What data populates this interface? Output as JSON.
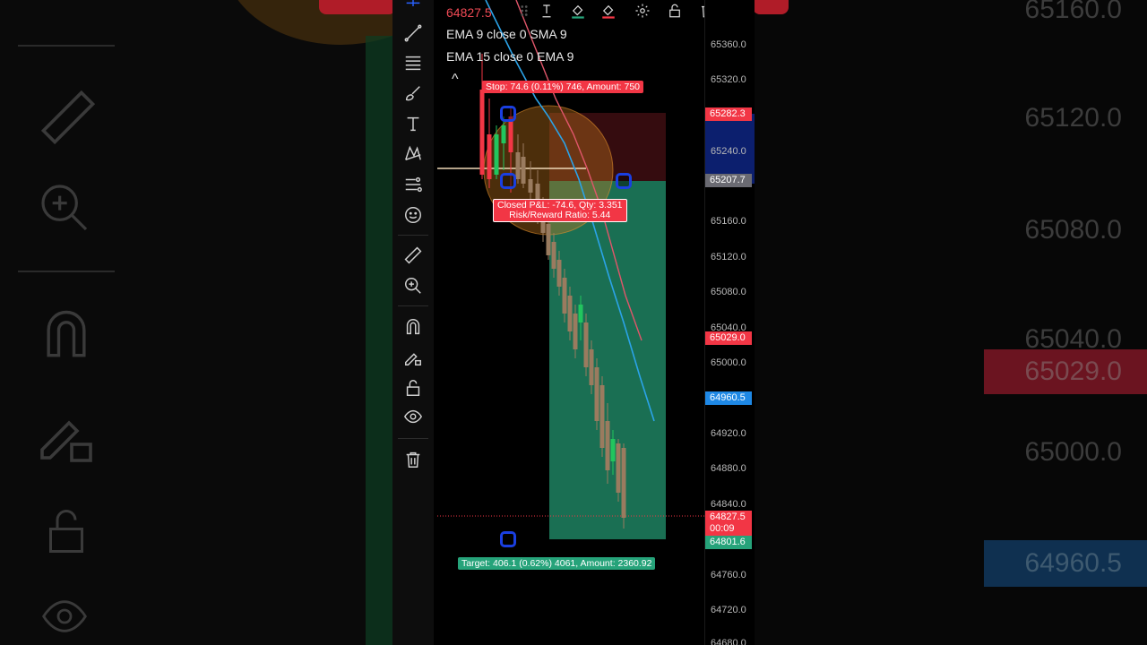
{
  "bg_prices": [
    "65160.0",
    "65120.0",
    "65080.0",
    "65040.0",
    "65029.0",
    "65000.0",
    "64960.5"
  ],
  "chart": {
    "current_price": "64827.5",
    "legend": [
      "EMA 9 close 0 SMA 9",
      "EMA 15 close 0 EMA 9"
    ],
    "stop_label": "Stop: 74.6 (0.11%) 746, Amount: 750",
    "closed_pnl_line1": "Closed P&L: -74.6, Qty: 3.351",
    "closed_pnl_line2": "Risk/Reward Ratio: 5.44",
    "target_label": "Target: 406.1 (0.62%) 4061, Amount: 2360.92",
    "collapse_glyph": "^"
  },
  "axis": {
    "ticks": [
      "65360.0",
      "65320.0",
      "65240.0",
      "65160.0",
      "65120.0",
      "65080.0",
      "65040.0",
      "65000.0",
      "64920.0",
      "64880.0",
      "64840.0",
      "64760.0",
      "64720.0",
      "64680.0"
    ],
    "tags": {
      "stop_price": "65282.3",
      "entry_price": "65207.7",
      "ema_price": "65029.0",
      "sma_price": "64960.5",
      "last_price": "64827.5",
      "countdown": "00:09",
      "target_price": "64801.6"
    }
  },
  "colors": {
    "up": "#22c55e",
    "down": "#9a7b5f",
    "loss": "#f23645",
    "profit": "#26a37a",
    "ema_blue": "#2ba3e8",
    "ema_red": "#e0566a",
    "handle": "#1a3fe0"
  }
}
